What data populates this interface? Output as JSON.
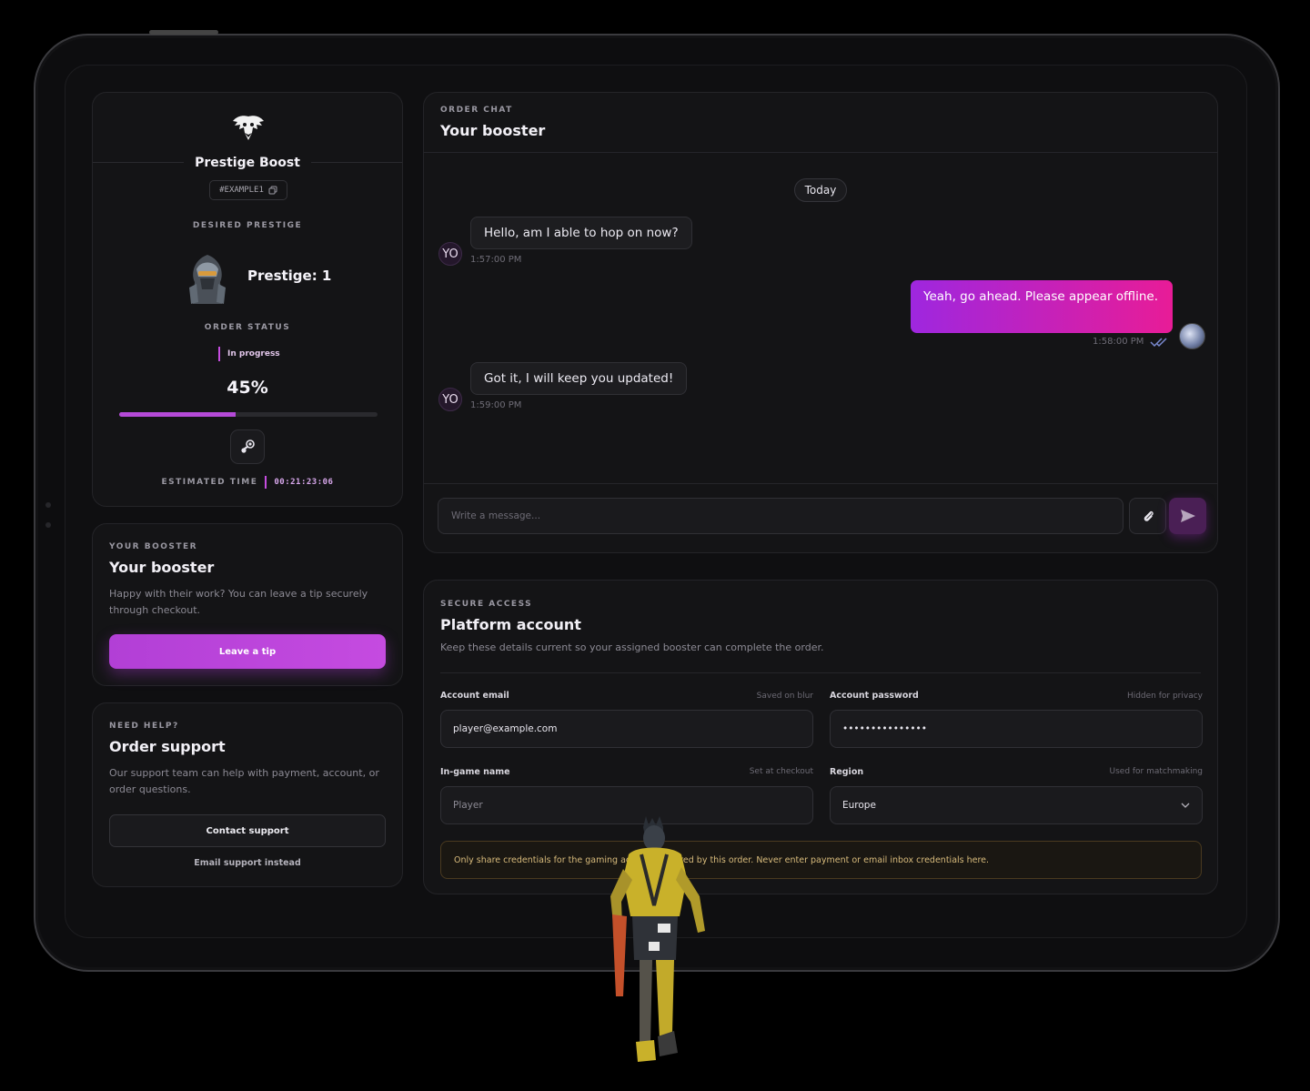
{
  "order": {
    "brand": "Prestige Boost",
    "order_id": "#EXAMPLE1",
    "desired_label": "DESIRED PRESTIGE",
    "prestige_text": "Prestige: 1",
    "status_label": "ORDER STATUS",
    "status_value": "In progress",
    "progress_text": "45%",
    "progress_value": 0.45,
    "estimated_label": "ESTIMATED TIME",
    "estimated_time": "00:21:23:06"
  },
  "booster_card": {
    "eyebrow": "YOUR BOOSTER",
    "title": "Your booster",
    "description": "Happy with their work? You can leave a tip securely through checkout.",
    "tip_button": "Leave a tip"
  },
  "support_card": {
    "eyebrow": "NEED HELP?",
    "title": "Order support",
    "description": "Our support team can help with payment, account, or order questions.",
    "contact_button": "Contact support",
    "email_link": "Email support instead"
  },
  "chat": {
    "eyebrow": "ORDER CHAT",
    "title": "Your booster",
    "day_separator": "Today",
    "messages": [
      {
        "sender": "YO",
        "text": "Hello, am I able to hop on now?",
        "time": "1:57:00 PM"
      },
      {
        "sender": "me",
        "text": "Yeah, go ahead. Please appear offline.",
        "time": "1:58:00 PM"
      },
      {
        "sender": "YO",
        "text": "Got it, I will keep you updated!",
        "time": "1:59:00 PM"
      }
    ],
    "input_placeholder": "Write a message...",
    "accent_gradient": [
      "#9e27df",
      "#e81c97"
    ]
  },
  "account": {
    "eyebrow": "SECURE ACCESS",
    "title": "Platform account",
    "description": "Keep these details current so your assigned booster can complete the order.",
    "email_label": "Account email",
    "email_hint": "Saved on blur",
    "email_value": "player@example.com",
    "password_label": "Account password",
    "password_hint": "Hidden for privacy",
    "password_value": "•••••••••••••••",
    "ign_label": "In-game name",
    "ign_hint": "Set at checkout",
    "ign_value": "Player",
    "region_label": "Region",
    "region_hint": "Used for matchmaking",
    "region_value": "Europe",
    "warning": "Only share credentials for the gaming account required by this order. Never enter payment or email inbox credentials here."
  },
  "colors": {
    "accent": "#c64de0",
    "background": "#0f0f11",
    "warning_text": "#d8bb7c"
  }
}
